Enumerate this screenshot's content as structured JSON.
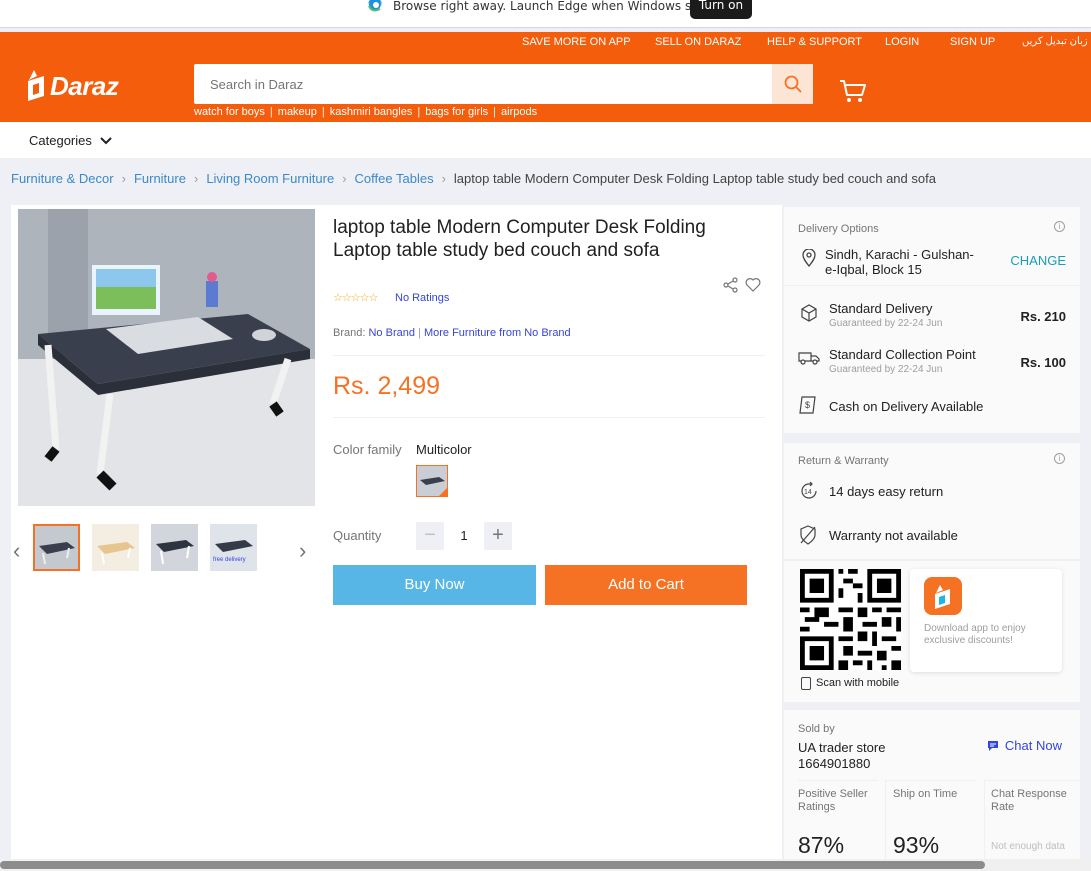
{
  "edge_bar": {
    "message": "Browse right away. Launch Edge when Windows starts.",
    "button": "Turn on"
  },
  "header": {
    "top_links": [
      "SAVE MORE ON APP",
      "SELL ON DARAZ",
      "HELP & SUPPORT",
      "LOGIN",
      "SIGN UP",
      "زبان تبدیل کریں"
    ],
    "logo_text": "Daraz",
    "search_placeholder": "Search in Daraz",
    "suggestions": [
      "watch for boys",
      "makeup",
      "kashmiri bangles",
      "bags for girls",
      "airpods"
    ],
    "brand_color": "#f45d0c"
  },
  "categories": {
    "label": "Categories"
  },
  "breadcrumb": {
    "items": [
      "Furniture & Decor",
      "Furniture",
      "Living Room Furniture",
      "Coffee Tables"
    ],
    "current": "laptop table Modern Computer Desk Folding Laptop table study bed couch and sofa"
  },
  "product": {
    "title": "laptop table Modern Computer Desk Folding Laptop table study bed couch and sofa",
    "ratings_text": "No Ratings",
    "brand_label": "Brand:",
    "brand_value": "No Brand",
    "more_from": "More Furniture from No Brand",
    "price": "Rs. 2,499",
    "color_label": "Color family",
    "color_value": "Multicolor",
    "quantity_label": "Quantity",
    "quantity": "1",
    "minus": "−",
    "plus": "+",
    "buy_now": "Buy Now",
    "add_to_cart": "Add to Cart",
    "thumb_overlay_text": "free delivery"
  },
  "delivery": {
    "section_label": "Delivery Options",
    "location": "Sindh, Karachi - Gulshan-e-Iqbal, Block 15",
    "change": "CHANGE",
    "options": [
      {
        "name": "Standard Delivery",
        "sub": "Guaranteed by 22-24 Jun",
        "price": "Rs. 210"
      },
      {
        "name": "Standard Collection Point",
        "sub": "Guaranteed by 22-24 Jun",
        "price": "Rs. 100"
      }
    ],
    "cod": "Cash on Delivery Available",
    "return_label": "Return & Warranty",
    "return": "14 days easy return",
    "return_icon_text": "14",
    "warranty": "Warranty not available"
  },
  "app_promo": {
    "scan_text": "Scan with mobile",
    "text": "Download app to enjoy exclusive discounts!"
  },
  "seller": {
    "sold_by_label": "Sold by",
    "name": "UA trader store 1664901880",
    "chat_now": "Chat Now",
    "metrics": [
      {
        "label": "Positive Seller Ratings",
        "value": "87%"
      },
      {
        "label": "Ship on Time",
        "value": "93%"
      },
      {
        "label": "Chat Response Rate",
        "value": "Not enough data"
      }
    ]
  }
}
